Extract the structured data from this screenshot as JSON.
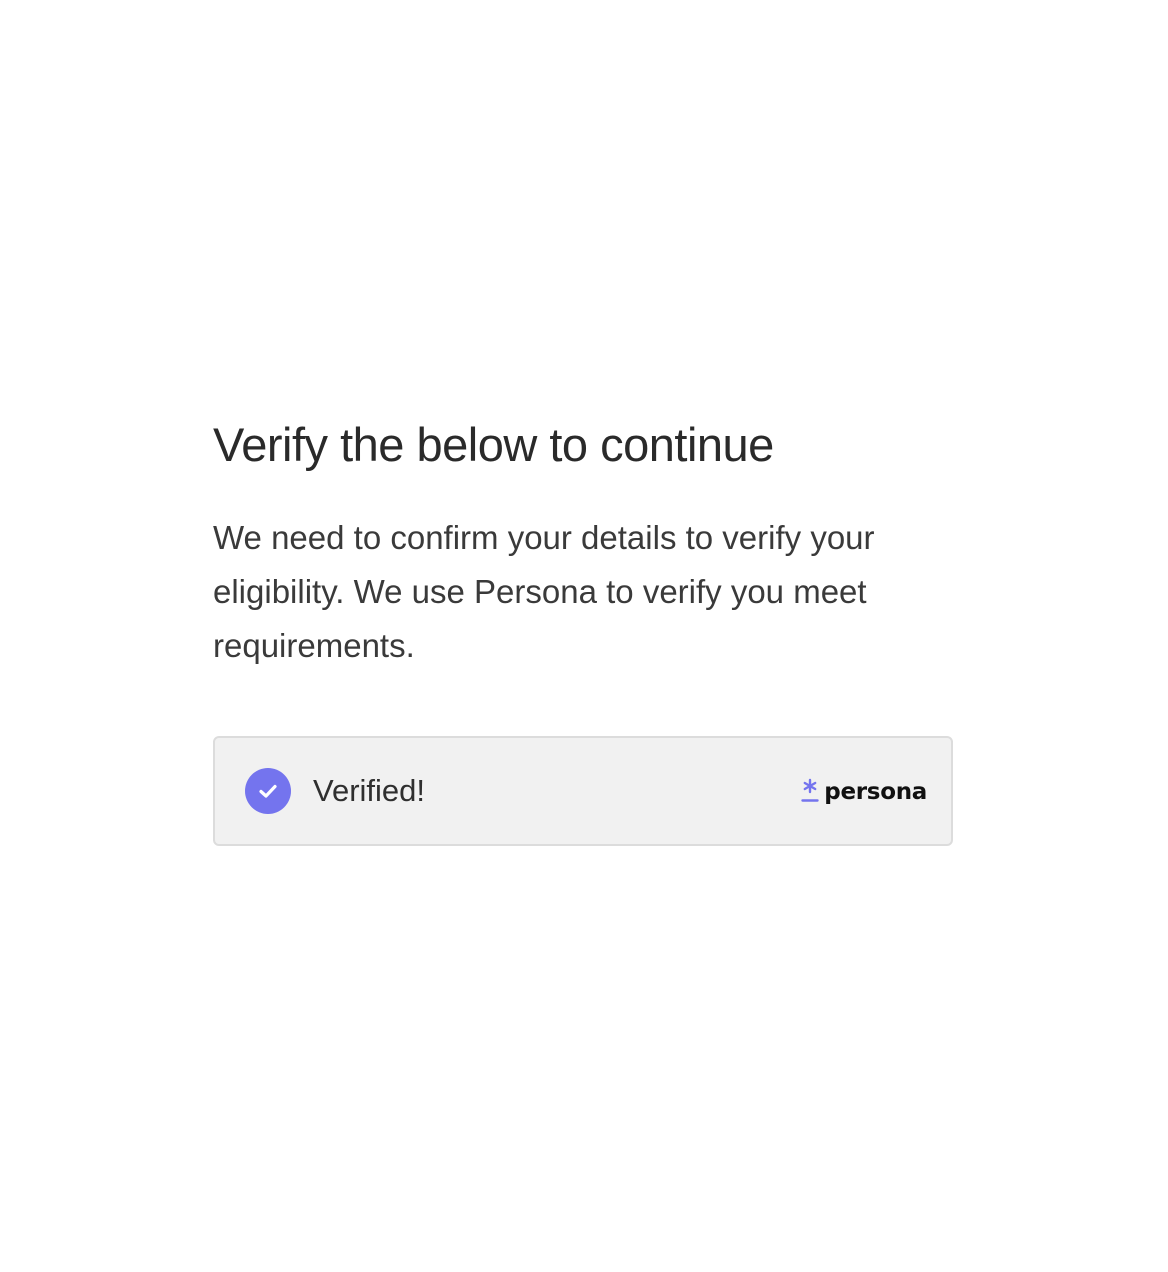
{
  "heading": {
    "title": "Verify the below to continue",
    "description": "We need to confirm your details to verify your eligibility. We use Persona to verify you meet requirements."
  },
  "verification": {
    "status_label": "Verified!",
    "status_icon": "check-circle-icon",
    "brand_name": "persona",
    "brand_icon": "persona-asterisk-icon",
    "colors": {
      "accent": "#7474EE",
      "box_background": "#F1F1F1",
      "box_border": "#DCDCDC"
    }
  }
}
